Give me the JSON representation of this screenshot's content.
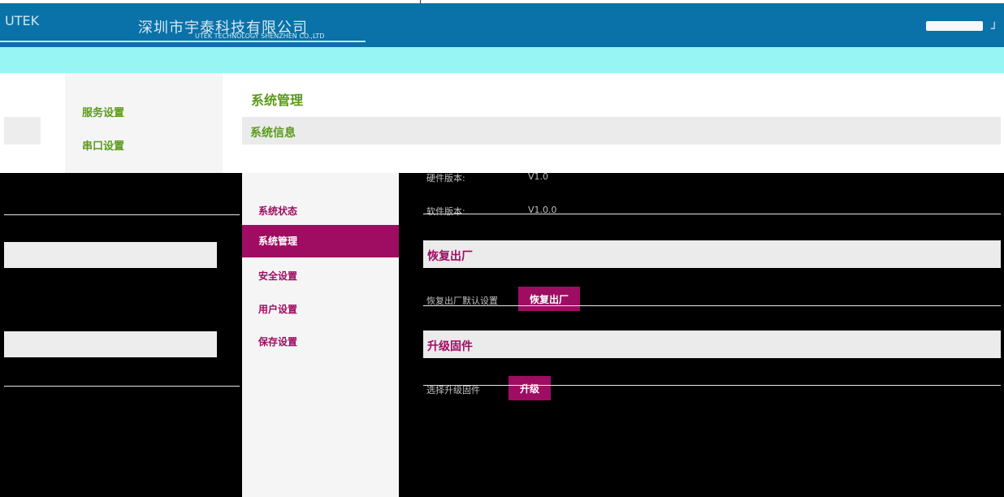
{
  "header": {
    "company_name_cn": "深圳市宇泰科技有限公司",
    "company_name_en": "UTEK TECHNOLOGY SHENZHEN CO.,LTD"
  },
  "nav_left": {
    "items": [
      {
        "label": "服务设置"
      },
      {
        "label": "串口设置"
      }
    ]
  },
  "page": {
    "title": "系统管理",
    "section": "系统信息"
  },
  "menu2": {
    "items": [
      {
        "label": "系统状态"
      },
      {
        "label": "系统管理",
        "active": true
      },
      {
        "label": "安全设置"
      },
      {
        "label": "用户设置"
      },
      {
        "label": "保存设置"
      }
    ]
  },
  "content": {
    "info_rows": [
      {
        "label": "硬件版本:",
        "value": "V1.0"
      },
      {
        "label": "软件版本:",
        "value": "V1.0.0"
      }
    ],
    "factory_section": {
      "title": "恢复出厂",
      "hint": "恢复出厂默认设置",
      "button": "恢复出厂"
    },
    "upgrade_section": {
      "title": "升级固件",
      "hint": "选择升级固件",
      "button": "升级"
    }
  },
  "colors": {
    "header_blue": "#0a72a8",
    "strip_cyan": "#97f6f4",
    "accent_magenta": "#9e0d62",
    "accent_green": "#5a9a1a"
  }
}
